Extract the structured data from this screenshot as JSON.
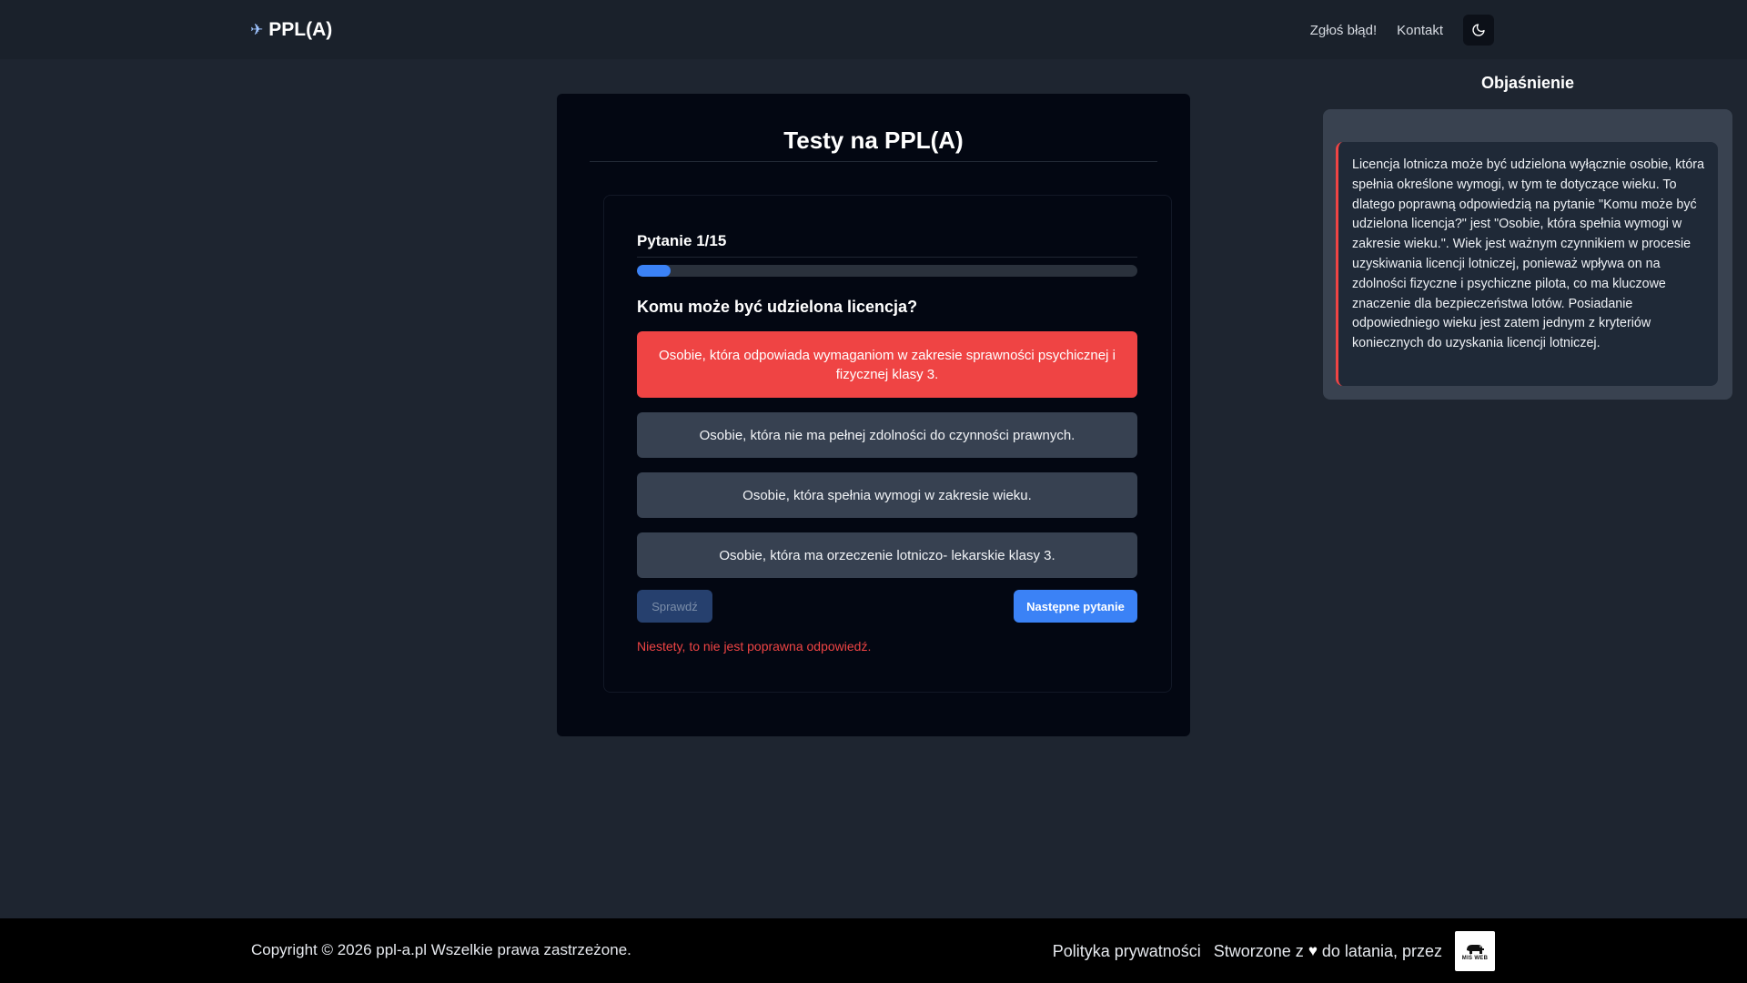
{
  "header": {
    "brand": "PPL(A)",
    "nav": [
      {
        "label": "Zgłoś błąd!"
      },
      {
        "label": "Kontakt"
      }
    ],
    "theme_toggle_icon": "moon-icon"
  },
  "quiz": {
    "title": "Testy na PPL(A)",
    "question_number": "Pytanie 1/15",
    "progress_fraction": 0.0667,
    "question": "Komu może być udzielona licencja?",
    "answers": [
      {
        "text": "Osobie, która odpowiada wymaganiom w zakresie sprawności psychicznej i fizycznej klasy 3.",
        "state": "wrong"
      },
      {
        "text": "Osobie, która nie ma pełnej zdolności do czynności prawnych.",
        "state": "default"
      },
      {
        "text": "Osobie, która spełnia wymogi w zakresie wieku.",
        "state": "default"
      },
      {
        "text": "Osobie, która ma orzeczenie lotniczo- lekarskie klasy 3.",
        "state": "default"
      }
    ],
    "check_label": "Sprawdź",
    "next_label": "Następne pytanie",
    "feedback": "Niestety, to nie jest poprawna odpowiedź."
  },
  "explanation": {
    "heading": "Objaśnienie",
    "text": "Licencja lotnicza może być udzielona wyłącznie osobie, która spełnia określone wymogi, w tym te dotyczące wieku. To dlatego poprawną odpowiedzią na pytanie \"Komu może być udzielona licencja?\" jest \"Osobie, która spełnia wymogi w zakresie wieku.\". Wiek jest ważnym czynnikiem w procesie uzyskiwania licencji lotniczej, ponieważ wpływa on na zdolności fizyczne i psychiczne pilota, co ma kluczowe znaczenie dla bezpieczeństwa lotów. Posiadanie odpowiedniego wieku jest zatem jednym z kryteriów koniecznych do uzyskania licencji lotniczej."
  },
  "footer": {
    "copyright": "Copyright © 2026 ppl-a.pl Wszelkie prawa zastrzeżone.",
    "privacy": "Polityka prywatności",
    "made_with_prefix": "Stworzone z",
    "made_with_suffix": "do latania, przez",
    "logo_text": "MIŚ WEB"
  },
  "colors": {
    "accent": "#3b82f6",
    "wrong": "#ef4444",
    "background": "#1e2530"
  }
}
